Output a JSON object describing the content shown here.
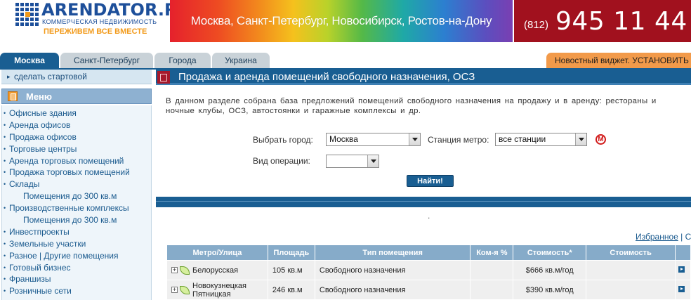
{
  "header": {
    "logo_name": "ARENDATOR.RU",
    "logo_sub": "КОММЕРЧЕСКАЯ НЕДВИЖИМОСТЬ",
    "logo_slogan": "ПЕРЕЖИВЕМ ВСЕ ВМЕСТЕ",
    "banner_text": "Москва, Санкт-Петербург, Новосибирск, Ростов-на-Дону",
    "phone_code": "(812)",
    "phone_number": "945 11 44"
  },
  "tabs": [
    {
      "label": "Москва",
      "active": true
    },
    {
      "label": "Санкт-Петербург",
      "active": false
    },
    {
      "label": "Города",
      "active": false
    },
    {
      "label": "Украина",
      "active": false
    }
  ],
  "widget_tab": "Новостный виджет. УСТАНОВИТЬ",
  "sidebar": {
    "make_start": "сделать стартовой",
    "menu_title": "Меню",
    "items": [
      {
        "label": "Офисные здания",
        "sub": false
      },
      {
        "label": "Аренда офисов",
        "sub": false
      },
      {
        "label": "Продажа офисов",
        "sub": false
      },
      {
        "label": "Торговые центры",
        "sub": false
      },
      {
        "label": "Аренда торговых помещений",
        "sub": false
      },
      {
        "label": "Продажа торговых помещений",
        "sub": false
      },
      {
        "label": "Склады",
        "sub": false
      },
      {
        "label": "Помещения до 300 кв.м",
        "sub": true
      },
      {
        "label": "Производственные комплексы",
        "sub": false
      },
      {
        "label": "Помещения до 300 кв.м",
        "sub": true
      },
      {
        "label": "Инвестпроекты",
        "sub": false
      },
      {
        "label": "Земельные участки",
        "sub": false
      },
      {
        "label": "Разное | Другие помещения",
        "sub": false
      },
      {
        "label": "Готовый бизнес",
        "sub": false
      },
      {
        "label": "Франшизы",
        "sub": false
      },
      {
        "label": "Розничные сети",
        "sub": false
      }
    ]
  },
  "content": {
    "title": "Продажа и аренда помещений свободного назначения, ОСЗ",
    "intro_line1": "В данном разделе собрана база предложений помещений свободного назначения на продажу и в аренду: рестораны и",
    "intro_line2": "ночные клубы, ОСЗ, автостоянки и гаражные комплексы и др.",
    "city_label": "Выбрать город:",
    "city_value": "Москва",
    "metro_label": "Станция метро:",
    "metro_value": "все станции",
    "metro_icon": "М",
    "operation_label": "Вид операции:",
    "operation_value": "",
    "search_button": "Найти!",
    "dot": ".",
    "fav_link": "Избранное",
    "fav_sep": " | С"
  },
  "table": {
    "headers": [
      "Метро/Улица",
      "Площадь",
      "Тип помещения",
      "Ком-я %",
      "Стоимость*",
      "Стоимость",
      ""
    ],
    "rows": [
      {
        "metro": "Белорусская",
        "area": "105 кв.м",
        "type": "Свободного назначения",
        "commission": "",
        "price": "$666 кв.м/год",
        "price2": ""
      },
      {
        "metro": "Новокузнецкая Пятницкая",
        "area": "246 кв.м",
        "type": "Свободного назначения",
        "commission": "",
        "price": "$390 кв.м/год",
        "price2": ""
      }
    ]
  },
  "colors": {
    "brand_blue": "#195e92",
    "phone_red": "#a1111e",
    "widget_orange": "#f29a4a",
    "logo_orange": "#f29a1a",
    "table_header": "#86abc9"
  }
}
